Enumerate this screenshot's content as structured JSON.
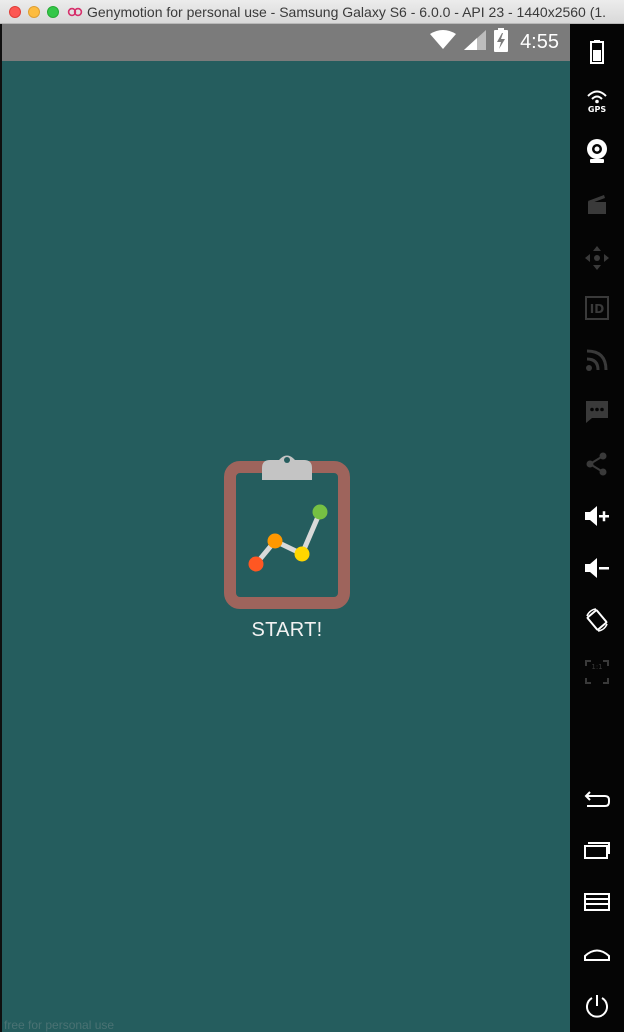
{
  "window": {
    "title": "Genymotion for personal use - Samsung Galaxy S6 - 6.0.0 - API 23 - 1440x2560 (1..."
  },
  "status_bar": {
    "time": "4:55",
    "icons": [
      "wifi-icon",
      "signal-icon",
      "battery-charging-icon"
    ]
  },
  "main": {
    "start_label": "START!",
    "icon": "clipboard-chart-icon",
    "colors": {
      "background": "#255d5e",
      "clipboard_frame": "#9e645c",
      "clip": "#c4c4c4",
      "point_red": "#ff5722",
      "point_orange": "#ff9800",
      "point_yellow": "#ffd600",
      "point_green": "#76c043"
    }
  },
  "footer": {
    "watermark": "free for personal use"
  },
  "toolbar": {
    "tools": [
      {
        "icon": "battery-icon"
      },
      {
        "icon": "gps-icon",
        "label": "GPS"
      },
      {
        "icon": "webcam-icon"
      },
      {
        "icon": "capture-icon"
      },
      {
        "icon": "dpad-icon"
      },
      {
        "icon": "device-id-icon",
        "label": "ID"
      },
      {
        "icon": "network-icon"
      },
      {
        "icon": "sms-icon"
      },
      {
        "icon": "share-icon"
      },
      {
        "icon": "volume-up-icon"
      },
      {
        "icon": "volume-down-icon"
      },
      {
        "icon": "rotate-icon"
      },
      {
        "icon": "pixel-perfect-icon",
        "label": "1:1"
      },
      {
        "icon": "back-icon"
      },
      {
        "icon": "recent-apps-icon"
      },
      {
        "icon": "menu-icon"
      },
      {
        "icon": "home-icon"
      },
      {
        "icon": "power-icon"
      }
    ]
  }
}
